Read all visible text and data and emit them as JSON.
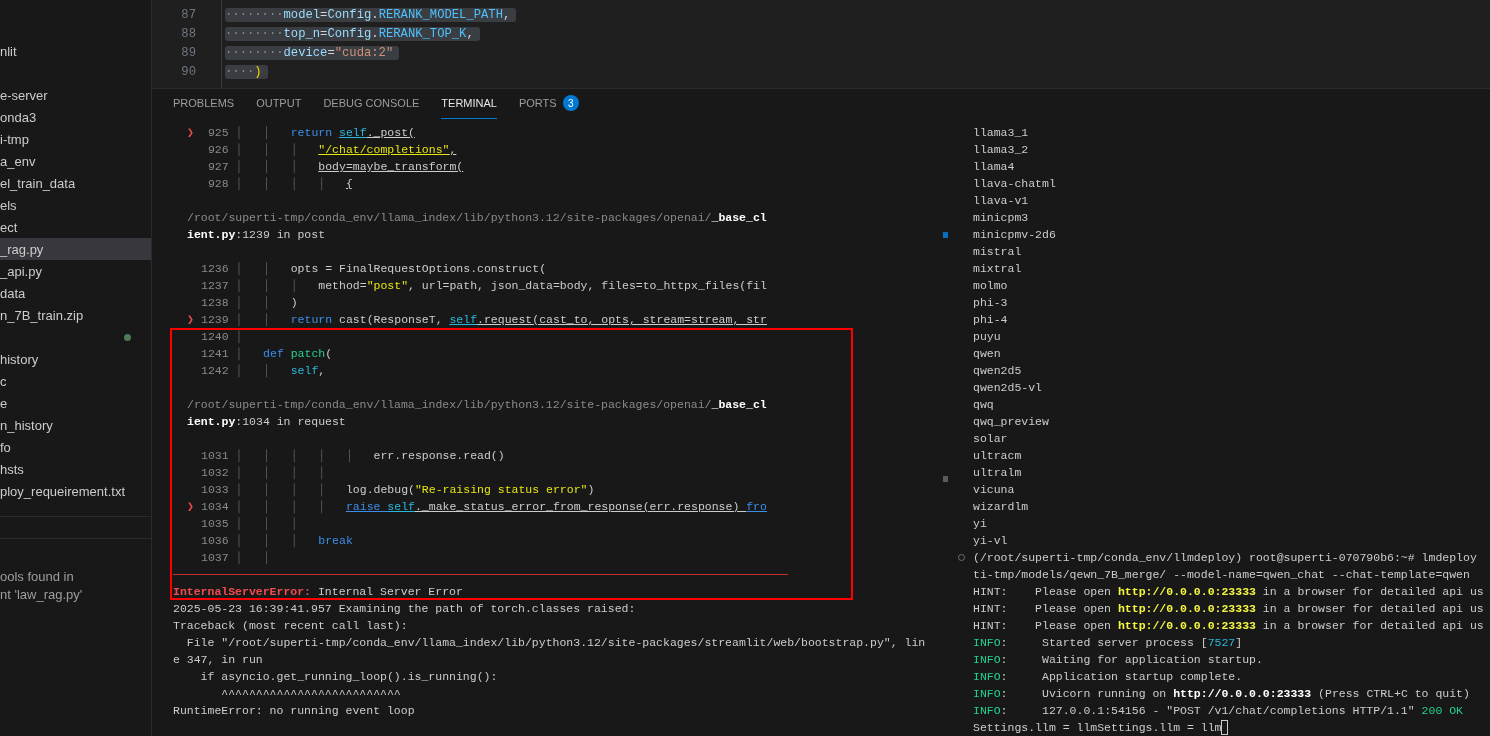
{
  "sidebar": {
    "items": [
      {
        "label": "nlit",
        "selected": false,
        "modified": false
      },
      {
        "label": "e-server",
        "selected": false,
        "modified": false
      },
      {
        "label": "onda3",
        "selected": false,
        "modified": false
      },
      {
        "label": "i-tmp",
        "selected": false,
        "modified": false
      },
      {
        "label": "a_env",
        "selected": false,
        "modified": false
      },
      {
        "label": "el_train_data",
        "selected": false,
        "modified": false
      },
      {
        "label": "els",
        "selected": false,
        "modified": false
      },
      {
        "label": "ect",
        "selected": false,
        "modified": false
      },
      {
        "label": "_rag.py",
        "selected": true,
        "modified": false
      },
      {
        "label": "_api.py",
        "selected": false,
        "modified": false
      },
      {
        "label": "data",
        "selected": false,
        "modified": false
      },
      {
        "label": "n_7B_train.zip",
        "selected": false,
        "modified": false
      },
      {
        "selected": false,
        "modified": true
      },
      {
        "label": "history",
        "selected": false,
        "modified": false
      },
      {
        "label": "c",
        "selected": false,
        "modified": false
      },
      {
        "label": "e",
        "selected": false,
        "modified": false
      },
      {
        "label": "n_history",
        "selected": false,
        "modified": false
      },
      {
        "label": "fo",
        "selected": false,
        "modified": false
      },
      {
        "label": "hsts",
        "selected": false,
        "modified": false
      },
      {
        "label": "ploy_requeirement.txt",
        "selected": false,
        "modified": false
      }
    ],
    "message_lines": [
      "ools found in",
      "nt 'law_rag.py'"
    ]
  },
  "editor": {
    "lines": [
      {
        "number": "87",
        "selected": true,
        "tokens": [
          {
            "kind": "ws",
            "t": "········"
          },
          {
            "kind": "param",
            "t": "model"
          },
          {
            "kind": "op",
            "t": "="
          },
          {
            "kind": "param",
            "t": "Config"
          },
          {
            "kind": "op",
            "t": "."
          },
          {
            "kind": "const",
            "t": "RERANK_MODEL_PATH"
          },
          {
            "kind": "op",
            "t": ","
          }
        ]
      },
      {
        "number": "88",
        "selected": true,
        "tokens": [
          {
            "kind": "ws",
            "t": "········"
          },
          {
            "kind": "param",
            "t": "top_n"
          },
          {
            "kind": "op",
            "t": "="
          },
          {
            "kind": "param",
            "t": "Config"
          },
          {
            "kind": "op",
            "t": "."
          },
          {
            "kind": "const",
            "t": "RERANK_TOP_K"
          },
          {
            "kind": "op",
            "t": ","
          }
        ]
      },
      {
        "number": "89",
        "selected": true,
        "tokens": [
          {
            "kind": "ws",
            "t": "········"
          },
          {
            "kind": "param",
            "t": "device"
          },
          {
            "kind": "op",
            "t": "="
          },
          {
            "kind": "estr",
            "t": "\"cuda:2\""
          }
        ]
      },
      {
        "number": "90",
        "selected": true,
        "tokens": [
          {
            "kind": "ws",
            "t": "····"
          },
          {
            "kind": "brace",
            "t": ")"
          }
        ]
      }
    ]
  },
  "panel_tabs": [
    {
      "label": "PROBLEMS",
      "selected": false
    },
    {
      "label": "OUTPUT",
      "selected": false
    },
    {
      "label": "DEBUG CONSOLE",
      "selected": false
    },
    {
      "label": "TERMINAL",
      "selected": true
    },
    {
      "label": "PORTS",
      "selected": false,
      "badge": "3"
    }
  ],
  "terminal_left": {
    "lines": [
      {
        "kind": "frame",
        "marker": "❯",
        "number": "925",
        "tokens": [
          {
            "kind": "guide",
            "t": " │   │   "
          },
          {
            "kind": "kw",
            "t": "return "
          },
          {
            "kind": "selfu",
            "t": "self"
          },
          {
            "kind": "plainu",
            "t": "._post("
          }
        ]
      },
      {
        "kind": "frame",
        "number": "926",
        "tokens": [
          {
            "kind": "guide",
            "t": " │   │   │   "
          },
          {
            "kind": "stru",
            "t": "\"/chat/completions\""
          },
          {
            "kind": "plainu",
            "t": ","
          }
        ]
      },
      {
        "kind": "frame",
        "number": "927",
        "tokens": [
          {
            "kind": "guide",
            "t": " │   │   │   "
          },
          {
            "kind": "plainu",
            "t": "body=maybe_transform("
          }
        ]
      },
      {
        "kind": "frame",
        "number": "928",
        "tokens": [
          {
            "kind": "guide",
            "t": " │   │   │   │   "
          },
          {
            "kind": "plainu",
            "t": "{"
          }
        ]
      },
      {
        "kind": "blank"
      },
      {
        "kind": "path",
        "tokens": [
          {
            "kind": "dim",
            "t": "/root/superti-tmp/conda_env/llama_index/lib/python3.12/site-packages/openai/"
          },
          {
            "kind": "bold",
            "t": "_base_cl"
          }
        ]
      },
      {
        "kind": "path",
        "tokens": [
          {
            "kind": "bold",
            "t": "ient.py"
          },
          {
            "kind": "plain",
            "t": ":1239 in post"
          }
        ]
      },
      {
        "kind": "blank"
      },
      {
        "kind": "frame",
        "number": "1236",
        "tokens": [
          {
            "kind": "guide",
            "t": " │   │   "
          },
          {
            "kind": "plain",
            "t": "opts = FinalRequestOptions.construct("
          }
        ]
      },
      {
        "kind": "frame",
        "number": "1237",
        "tokens": [
          {
            "kind": "guide",
            "t": " │   │   │   "
          },
          {
            "kind": "plain",
            "t": "method="
          },
          {
            "kind": "str",
            "t": "\"post\""
          },
          {
            "kind": "plain",
            "t": ", url=path, json_data=body, files=to_httpx_files(fil"
          }
        ]
      },
      {
        "kind": "frame",
        "number": "1238",
        "tokens": [
          {
            "kind": "guide",
            "t": " │   │   "
          },
          {
            "kind": "plain",
            "t": ")"
          }
        ]
      },
      {
        "kind": "frame",
        "marker": "❯",
        "number": "1239",
        "tokens": [
          {
            "kind": "guide",
            "t": " │   │   "
          },
          {
            "kind": "kw",
            "t": "return "
          },
          {
            "kind": "plain",
            "t": "cast(ResponseT, "
          },
          {
            "kind": "selfu",
            "t": "self"
          },
          {
            "kind": "plainu",
            "t": ".request(cast_to, opts, stream=stream, str"
          }
        ]
      },
      {
        "kind": "frame",
        "number": "1240",
        "tokens": [
          {
            "kind": "guide",
            "t": " │"
          }
        ]
      },
      {
        "kind": "frame",
        "number": "1241",
        "tokens": [
          {
            "kind": "guide",
            "t": " │   "
          },
          {
            "kind": "kw",
            "t": "def "
          },
          {
            "kind": "fn",
            "t": "patch"
          },
          {
            "kind": "plain",
            "t": "("
          }
        ]
      },
      {
        "kind": "frame",
        "number": "1242",
        "tokens": [
          {
            "kind": "guide",
            "t": " │   │   "
          },
          {
            "kind": "self",
            "t": "self"
          },
          {
            "kind": "plain",
            "t": ","
          }
        ]
      },
      {
        "kind": "blank"
      },
      {
        "kind": "path",
        "tokens": [
          {
            "kind": "dim",
            "t": "/root/superti-tmp/conda_env/llama_index/lib/python3.12/site-packages/openai/"
          },
          {
            "kind": "bold",
            "t": "_base_cl"
          }
        ]
      },
      {
        "kind": "path",
        "tokens": [
          {
            "kind": "bold",
            "t": "ient.py"
          },
          {
            "kind": "plain",
            "t": ":1034 in request"
          }
        ]
      },
      {
        "kind": "blank"
      },
      {
        "kind": "frame",
        "number": "1031",
        "tokens": [
          {
            "kind": "guide",
            "t": " │   │   │   │   │   "
          },
          {
            "kind": "plain",
            "t": "err.response.read()"
          }
        ]
      },
      {
        "kind": "frame",
        "number": "1032",
        "tokens": [
          {
            "kind": "guide",
            "t": " │   │   │   │"
          }
        ]
      },
      {
        "kind": "frame",
        "number": "1033",
        "tokens": [
          {
            "kind": "guide",
            "t": " │   │   │   │   "
          },
          {
            "kind": "plain",
            "t": "log.debug("
          },
          {
            "kind": "str",
            "t": "\"Re-raising status error\""
          },
          {
            "kind": "plain",
            "t": ")"
          }
        ]
      },
      {
        "kind": "frame",
        "marker": "❯",
        "number": "1034",
        "tokens": [
          {
            "kind": "guide",
            "t": " │   │   │   │   "
          },
          {
            "kind": "kwu",
            "t": "raise "
          },
          {
            "kind": "selfu",
            "t": "self"
          },
          {
            "kind": "plainu",
            "t": "._make_status_error_from_response(err.response) "
          },
          {
            "kind": "kwu",
            "t": "fro"
          }
        ]
      },
      {
        "kind": "frame",
        "number": "1035",
        "tokens": [
          {
            "kind": "guide",
            "t": " │   │   │"
          }
        ]
      },
      {
        "kind": "frame",
        "number": "1036",
        "tokens": [
          {
            "kind": "guide",
            "t": " │   │   │   "
          },
          {
            "kind": "kw",
            "t": "break"
          }
        ]
      },
      {
        "kind": "frame",
        "number": "1037",
        "tokens": [
          {
            "kind": "guide",
            "t": " │   │"
          }
        ]
      },
      {
        "kind": "rule"
      },
      {
        "kind": "out",
        "tokens": [
          {
            "kind": "err",
            "t": "InternalServerError:"
          },
          {
            "kind": "plain",
            "t": " Internal Server Error"
          }
        ]
      },
      {
        "kind": "out",
        "tokens": [
          {
            "kind": "plain",
            "t": "2025-05-23 16:39:41.957 Examining the path of torch.classes raised:"
          }
        ]
      },
      {
        "kind": "out",
        "tokens": [
          {
            "kind": "plain",
            "t": "Traceback (most recent call last):"
          }
        ]
      },
      {
        "kind": "out",
        "tokens": [
          {
            "kind": "plain",
            "t": "  File \"/root/superti-tmp/conda_env/llama_index/lib/python3.12/site-packages/streamlit/web/bootstrap.py\", lin"
          }
        ]
      },
      {
        "kind": "out",
        "tokens": [
          {
            "kind": "plain",
            "t": "e 347, in run"
          }
        ]
      },
      {
        "kind": "out",
        "tokens": [
          {
            "kind": "plain",
            "t": "    if asyncio.get_running_loop().is_running():"
          }
        ]
      },
      {
        "kind": "out",
        "tokens": [
          {
            "kind": "plain",
            "t": "       ^^^^^^^^^^^^^^^^^^^^^^^^^^"
          }
        ]
      },
      {
        "kind": "out",
        "tokens": [
          {
            "kind": "plain",
            "t": "RuntimeError: no running event loop"
          }
        ]
      }
    ]
  },
  "terminal_right": {
    "lines": [
      {
        "kind": "output",
        "tokens": [
          {
            "kind": "plain",
            "t": "llama3_1"
          }
        ]
      },
      {
        "kind": "output",
        "tokens": [
          {
            "kind": "plain",
            "t": "llama3_2"
          }
        ]
      },
      {
        "kind": "output",
        "tokens": [
          {
            "kind": "plain",
            "t": "llama4"
          }
        ]
      },
      {
        "kind": "output",
        "tokens": [
          {
            "kind": "plain",
            "t": "llava-chatml"
          }
        ]
      },
      {
        "kind": "output",
        "tokens": [
          {
            "kind": "plain",
            "t": "llava-v1"
          }
        ]
      },
      {
        "kind": "output",
        "tokens": [
          {
            "kind": "plain",
            "t": "minicpm3"
          }
        ]
      },
      {
        "kind": "output",
        "tokens": [
          {
            "kind": "plain",
            "t": "minicpmv-2d6"
          }
        ]
      },
      {
        "kind": "output",
        "tokens": [
          {
            "kind": "plain",
            "t": "mistral"
          }
        ]
      },
      {
        "kind": "output",
        "tokens": [
          {
            "kind": "plain",
            "t": "mixtral"
          }
        ]
      },
      {
        "kind": "output",
        "tokens": [
          {
            "kind": "plain",
            "t": "molmo"
          }
        ]
      },
      {
        "kind": "output",
        "tokens": [
          {
            "kind": "plain",
            "t": "phi-3"
          }
        ]
      },
      {
        "kind": "output",
        "tokens": [
          {
            "kind": "plain",
            "t": "phi-4"
          }
        ]
      },
      {
        "kind": "output",
        "tokens": [
          {
            "kind": "plain",
            "t": "puyu"
          }
        ]
      },
      {
        "kind": "output",
        "tokens": [
          {
            "kind": "plain",
            "t": "qwen"
          }
        ]
      },
      {
        "kind": "output",
        "tokens": [
          {
            "kind": "plain",
            "t": "qwen2d5"
          }
        ]
      },
      {
        "kind": "output",
        "tokens": [
          {
            "kind": "plain",
            "t": "qwen2d5-vl"
          }
        ]
      },
      {
        "kind": "output",
        "tokens": [
          {
            "kind": "plain",
            "t": "qwq"
          }
        ]
      },
      {
        "kind": "output",
        "tokens": [
          {
            "kind": "plain",
            "t": "qwq_preview"
          }
        ]
      },
      {
        "kind": "output",
        "tokens": [
          {
            "kind": "plain",
            "t": "solar"
          }
        ]
      },
      {
        "kind": "output",
        "tokens": [
          {
            "kind": "plain",
            "t": "ultracm"
          }
        ]
      },
      {
        "kind": "output",
        "tokens": [
          {
            "kind": "plain",
            "t": "ultralm"
          }
        ]
      },
      {
        "kind": "output",
        "tokens": [
          {
            "kind": "plain",
            "t": "vicuna"
          }
        ]
      },
      {
        "kind": "output",
        "tokens": [
          {
            "kind": "plain",
            "t": "wizardlm"
          }
        ]
      },
      {
        "kind": "output",
        "tokens": [
          {
            "kind": "plain",
            "t": "yi"
          }
        ]
      },
      {
        "kind": "output",
        "tokens": [
          {
            "kind": "plain",
            "t": "yi-vl"
          }
        ]
      },
      {
        "kind": "prompt",
        "tokens": [
          {
            "kind": "plain",
            "t": "(/root/superti-tmp/conda_env/llmdeploy) root@superti-070790b6:~# lmdeploy"
          }
        ]
      },
      {
        "kind": "output",
        "tokens": [
          {
            "kind": "plain",
            "t": "ti-tmp/models/qewn_7B_merge/ --model-name=qwen_chat --chat-template=qwen"
          }
        ]
      },
      {
        "kind": "output",
        "tokens": [
          {
            "kind": "plain",
            "t": "HINT:    Please open "
          },
          {
            "kind": "url",
            "t": "http://0.0.0.0:23333"
          },
          {
            "kind": "plain",
            "t": " in a browser for detailed api us"
          }
        ]
      },
      {
        "kind": "output",
        "tokens": [
          {
            "kind": "plain",
            "t": "HINT:    Please open "
          },
          {
            "kind": "url",
            "t": "http://0.0.0.0:23333"
          },
          {
            "kind": "plain",
            "t": " in a browser for detailed api us"
          }
        ]
      },
      {
        "kind": "output",
        "tokens": [
          {
            "kind": "plain",
            "t": "HINT:    Please open "
          },
          {
            "kind": "url",
            "t": "http://0.0.0.0:23333"
          },
          {
            "kind": "plain",
            "t": " in a browser for detailed api us"
          }
        ]
      },
      {
        "kind": "output",
        "tokens": [
          {
            "kind": "green",
            "t": "INFO"
          },
          {
            "kind": "plain",
            "t": ":     Started server process ["
          },
          {
            "kind": "cyan",
            "t": "7527"
          },
          {
            "kind": "plain",
            "t": "]"
          }
        ]
      },
      {
        "kind": "output",
        "tokens": [
          {
            "kind": "green",
            "t": "INFO"
          },
          {
            "kind": "plain",
            "t": ":     Waiting for application startup."
          }
        ]
      },
      {
        "kind": "output",
        "tokens": [
          {
            "kind": "green",
            "t": "INFO"
          },
          {
            "kind": "plain",
            "t": ":     Application startup complete."
          }
        ]
      },
      {
        "kind": "output",
        "tokens": [
          {
            "kind": "green",
            "t": "INFO"
          },
          {
            "kind": "plain",
            "t": ":     Uvicorn running on "
          },
          {
            "kind": "bold",
            "t": "http://0.0.0.0:23333"
          },
          {
            "kind": "plain",
            "t": " (Press CTRL+C to quit)"
          }
        ]
      },
      {
        "kind": "output",
        "tokens": [
          {
            "kind": "green",
            "t": "INFO"
          },
          {
            "kind": "plain",
            "t": ":     127.0.0.1:54156 - \"POST /v1/chat/completions HTTP/1.1\" "
          },
          {
            "kind": "green",
            "t": "200 OK"
          }
        ]
      },
      {
        "kind": "input",
        "tokens": [
          {
            "kind": "plain",
            "t": "Settings.llm = llmSettings.llm = llm"
          }
        ]
      }
    ]
  }
}
